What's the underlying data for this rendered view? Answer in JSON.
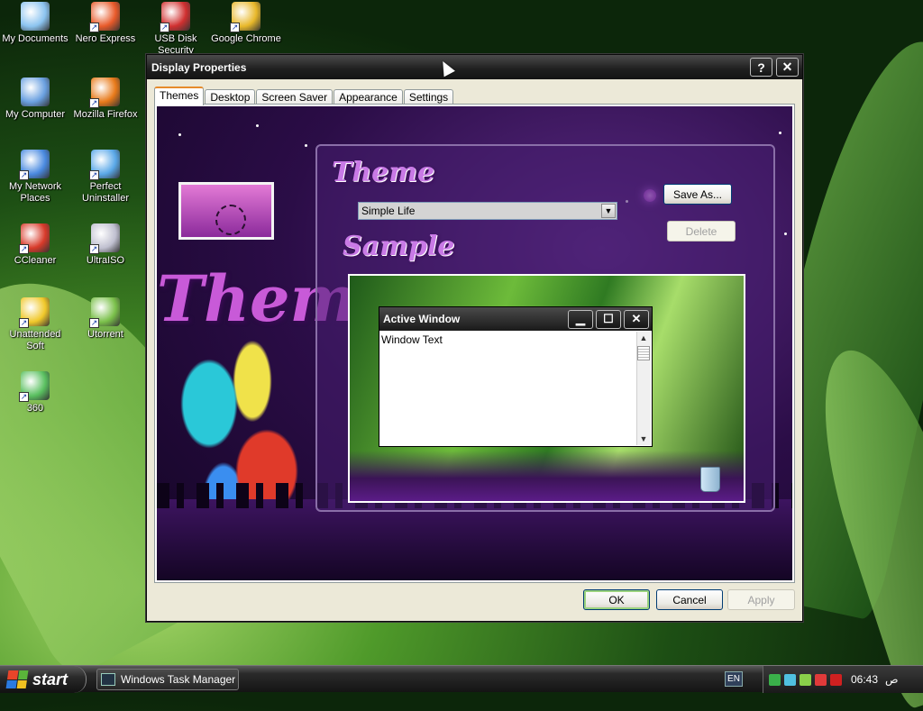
{
  "desktop": {
    "icons": [
      {
        "label": "My Documents",
        "icon": "folder-documents-icon",
        "color": "#8cc4f0"
      },
      {
        "label": "Nero Express",
        "icon": "nero-icon",
        "color": "#e85a2a"
      },
      {
        "label": "USB Disk Security",
        "icon": "usb-shield-icon",
        "color": "#d03030"
      },
      {
        "label": "Google Chrome",
        "icon": "chrome-icon",
        "color": "#e8b82a"
      },
      {
        "label": "My Computer",
        "icon": "computer-icon",
        "color": "#6aa0e0"
      },
      {
        "label": "Mozilla Firefox",
        "icon": "firefox-icon",
        "color": "#e87a1a"
      },
      {
        "label": "My Network Places",
        "icon": "network-icon",
        "color": "#4a8ae0"
      },
      {
        "label": "Perfect Uninstaller",
        "icon": "uninstaller-icon",
        "color": "#5aa8e8"
      },
      {
        "label": "CCleaner",
        "icon": "ccleaner-icon",
        "color": "#d83a2a"
      },
      {
        "label": "UltraISO",
        "icon": "ultraiso-icon",
        "color": "#c0c0d0"
      },
      {
        "label": "Unattended Soft",
        "icon": "star-icon",
        "color": "#f0c82a"
      },
      {
        "label": "Utorrent",
        "icon": "utorrent-icon",
        "color": "#7ac04a"
      },
      {
        "label": "360",
        "icon": "360-icon",
        "color": "#5ac060"
      }
    ]
  },
  "dialog": {
    "title": "Display Properties",
    "help_button": "?",
    "close_button": "✕",
    "tabs": [
      "Themes",
      "Desktop",
      "Screen Saver",
      "Appearance",
      "Settings"
    ],
    "active_tab": "Themes",
    "panel": {
      "theme_heading": "Theme",
      "theme_value": "Simple Life",
      "save_as_label": "Save As...",
      "delete_label": "Delete",
      "sample_heading": "Sample",
      "art_word": "Themes",
      "preview": {
        "window_title": "Active Window",
        "window_text": "Window Text",
        "min_glyph": "▁",
        "max_glyph": "☐",
        "close_glyph": "✕"
      }
    },
    "ok_label": "OK",
    "cancel_label": "Cancel",
    "apply_label": "Apply"
  },
  "taskbar": {
    "start_label": "start",
    "task_label": "Windows Task Manager",
    "language": "EN",
    "clock": "06:43",
    "ampm": "ص"
  }
}
